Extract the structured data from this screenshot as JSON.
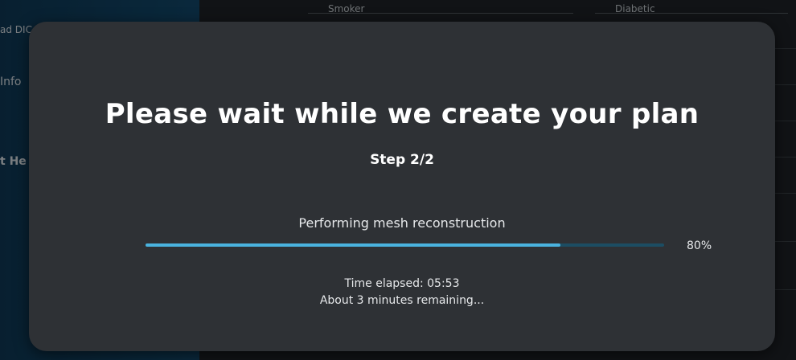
{
  "background": {
    "sidebar_items": [
      "ad DIC",
      "Info",
      "t He"
    ],
    "fields": [
      "Smoker",
      "Diabetic"
    ]
  },
  "modal": {
    "title": "Please wait while we create your plan",
    "step": "Step 2/2",
    "task": "Performing mesh reconstruction",
    "progress_fraction": 0.8,
    "progress_label": "80%",
    "time_elapsed": "Time elapsed: 05:53",
    "remaining": "About 3 minutes remaining..."
  },
  "colors": {
    "progress_fill": "#4ab3df",
    "progress_track": "#1c4d63",
    "modal_bg": "#2e3135"
  }
}
